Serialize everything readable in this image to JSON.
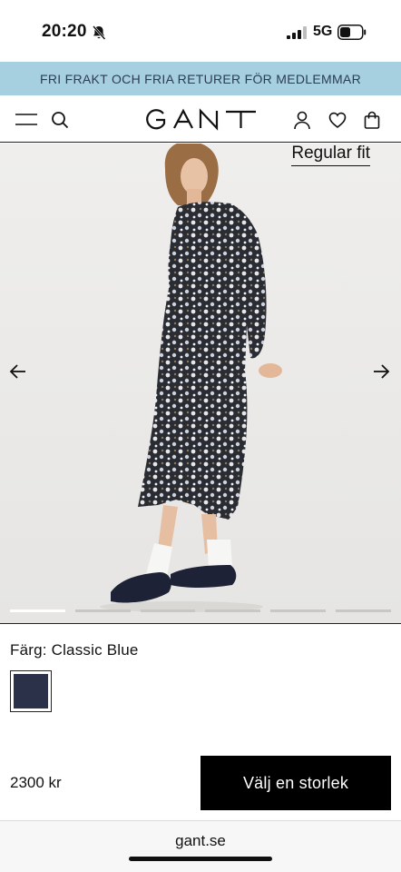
{
  "status_bar": {
    "time": "20:20",
    "network": "5G",
    "icons": [
      "bell-slash-icon",
      "signal-icon",
      "battery-icon"
    ]
  },
  "promo": {
    "text": "FRI FRAKT OCH FRIA RETURER FÖR MEDLEMMAR",
    "background": "#a6cfdf"
  },
  "header": {
    "logo": "GANT",
    "icons": [
      "menu-icon",
      "search-icon",
      "account-icon",
      "heart-icon",
      "bag-icon"
    ]
  },
  "gallery": {
    "fit_label": "Regular fit",
    "image_count": 6,
    "active_index": 0,
    "icons": [
      "arrow-left-icon",
      "arrow-right-icon"
    ]
  },
  "product": {
    "color_label": "Färg: Classic Blue",
    "swatch_color": "#2b3148",
    "price": "2300 kr",
    "cta_label": "Välj en storlek"
  },
  "browser": {
    "url": "gant.se"
  }
}
